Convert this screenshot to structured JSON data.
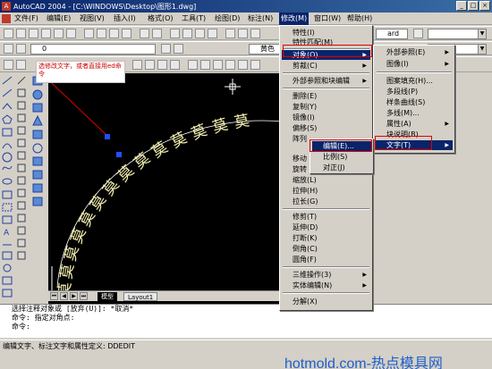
{
  "window": {
    "app_icon": "autocad-icon",
    "title": "AutoCAD 2004 - [C:\\WINDOWS\\Desktop\\图形1.dwg]",
    "buttons": [
      "_",
      "□",
      "×"
    ]
  },
  "menubar": {
    "items": [
      "文件(F)",
      "编辑(E)",
      "视图(V)",
      "插入(I)",
      "格式(O)",
      "工具(T)",
      "绘图(D)",
      "标注(N)",
      "修改(M)",
      "窗口(W)",
      "帮助(H)"
    ],
    "active": "修改(M)"
  },
  "toolbar": {
    "layer_combo": "0",
    "style_combo": "ard",
    "color_combo": "黄色"
  },
  "note": {
    "text": "选修改文字，或者直接用ed命令"
  },
  "drawing": {
    "arc_text": [
      "莫",
      "莫",
      "莫",
      "莫",
      "莫",
      "莫",
      "莫",
      "莫",
      "莫",
      "莫",
      "莫",
      "莫",
      "莫",
      "莫"
    ]
  },
  "tabs": {
    "model": "模型",
    "layout1": "Layout1"
  },
  "modify_menu": {
    "items": [
      {
        "label": "特性(I)"
      },
      {
        "label": "特性匹配(M)"
      },
      {
        "label": "对象(O)",
        "submenu": true
      },
      {
        "label": "剪裁(C)",
        "submenu": true
      },
      {
        "label": "外部参照和块编辑",
        "submenu": true
      },
      {
        "label": "删除(E)"
      },
      {
        "label": "复制(Y)"
      },
      {
        "label": "镜像(I)"
      },
      {
        "label": "偏移(S)"
      },
      {
        "label": "阵列"
      },
      {
        "label": "移动"
      },
      {
        "label": "旋转"
      },
      {
        "label": "缩放(L)"
      },
      {
        "label": "拉伸(H)"
      },
      {
        "label": "拉长(G)"
      },
      {
        "label": "修剪(T)"
      },
      {
        "label": "延伸(D)"
      },
      {
        "label": "打断(K)"
      },
      {
        "label": "倒角(C)"
      },
      {
        "label": "圆角(F)"
      },
      {
        "label": "三维操作(3)",
        "submenu": true
      },
      {
        "label": "实体编辑(N)",
        "submenu": true
      },
      {
        "label": "分解(X)"
      }
    ]
  },
  "object_submenu": {
    "items": [
      {
        "label": "外部参照(E)",
        "submenu": true
      },
      {
        "label": "图像(I)",
        "submenu": true
      },
      {
        "label": "图案填充(H)..."
      },
      {
        "label": "多段线(P)"
      },
      {
        "label": "样条曲线(S)"
      },
      {
        "label": "多线(M)..."
      },
      {
        "label": "属性(A)",
        "submenu": true
      },
      {
        "label": "块说明(B)"
      },
      {
        "label": "文字(T)",
        "submenu": true
      }
    ]
  },
  "text_submenu": {
    "items": [
      {
        "label": "编辑(E)..."
      },
      {
        "label": "比例(S)"
      },
      {
        "label": "对正(J)"
      }
    ]
  },
  "command": {
    "lines": [
      "选择注释对象或 [放弃(U)]:   *取消*",
      "命令:  指定对角点:",
      "命令:"
    ]
  },
  "statusbar": {
    "text": "编辑文字、标注文字和属性定义:  DDEDIT"
  },
  "watermark": {
    "text": "hotmold.com-热点模具网"
  },
  "colors": {
    "accent": "#0a246a",
    "highlight_box": "#e00000",
    "arc_text": "#f5f0b0"
  }
}
